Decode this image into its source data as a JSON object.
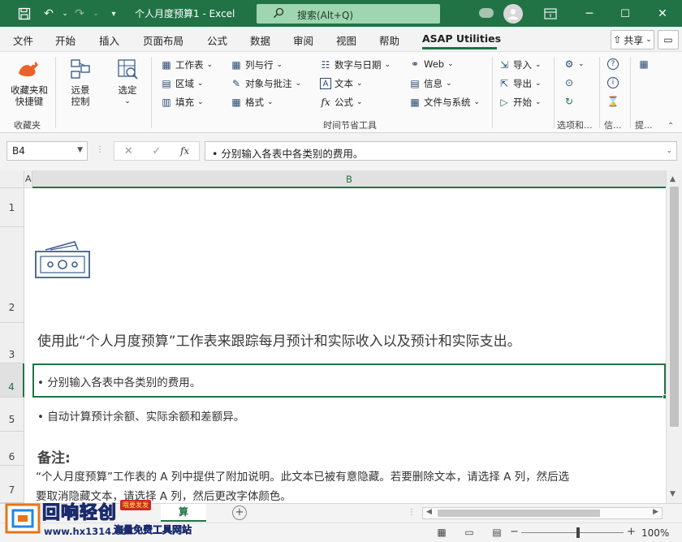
{
  "titlebar": {
    "title": "个人月度预算1  -  Excel",
    "search_placeholder": "搜索(Alt+Q)"
  },
  "tabs": [
    "文件",
    "开始",
    "插入",
    "页面布局",
    "公式",
    "数据",
    "审阅",
    "视图",
    "帮助",
    "ASAP Utilities"
  ],
  "active_tab": "ASAP Utilities",
  "share_label": "共享",
  "ribbon": {
    "favorites_label": "收藏夹和\n快捷键",
    "favorites_group": "收藏夹",
    "remote_label": "远景\n控制",
    "select_label": "选定",
    "col1": [
      "工作表",
      "区域",
      "填充"
    ],
    "col2": [
      "列与行",
      "对象与批注",
      "格式"
    ],
    "col3": [
      "数字与日期",
      "文本",
      "公式"
    ],
    "col4": [
      "Web",
      "信息",
      "文件与系统"
    ],
    "col5": [
      "导入",
      "导出",
      "开始"
    ],
    "timesaver_group": "时间节省工具",
    "options_group": "选项和...",
    "info_group": "信...",
    "tips_group": "提..."
  },
  "formula_bar": {
    "name_box": "B4",
    "formula": "• 分别输入各表中各类别的费用。"
  },
  "grid": {
    "col_a": "A",
    "col_b": "B",
    "rows": [
      "1",
      "2",
      "3",
      "4",
      "5",
      "6",
      "7"
    ],
    "row3": "使用此“个人月度预算”工作表来跟踪每月预计和实际收入以及预计和实际支出。",
    "row4": "• 分别输入各表中各类别的费用。",
    "row5": "• 自动计算预计余额、实际余额和差额异。",
    "row6_heading": "备注:",
    "row6_text": "“个人月度预算”工作表的 A 列中提供了附加说明。此文本已被有意隐藏。若要删除文本，请选择 A 列，然后选",
    "row7_text": "要取消隐藏文本，请选择 A 列，然后更改字体颜色。"
  },
  "sheet_tab": "算",
  "status": {
    "zoom": "100%"
  },
  "watermark": {
    "brand": "回响轻创",
    "badge": "哦要发发",
    "url": "www.hx1314.cc",
    "slogan": "海量免费工具网站"
  },
  "colors": {
    "accent": "#217346",
    "icon_blue": "#3d5f8f"
  }
}
